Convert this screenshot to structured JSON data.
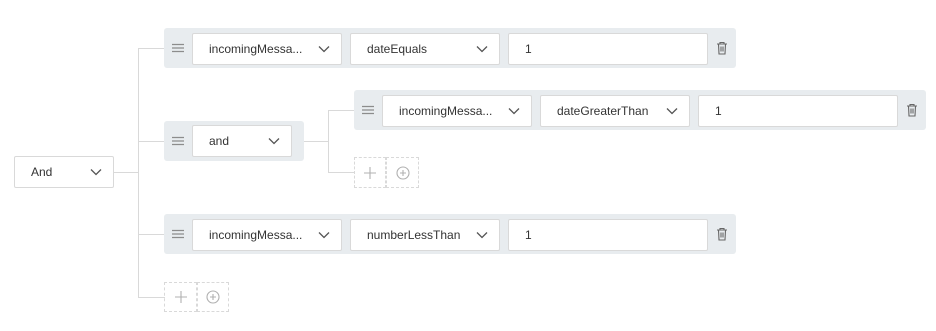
{
  "root": {
    "operator": "And"
  },
  "rules": [
    {
      "field": "incomingMessa...",
      "operator": "dateEquals",
      "value": "1"
    },
    {
      "group_operator": "and",
      "rules": [
        {
          "field": "incomingMessa...",
          "operator": "dateGreaterThan",
          "value": "1"
        }
      ]
    },
    {
      "field": "incomingMessa...",
      "operator": "numberLessThan",
      "value": "1"
    }
  ],
  "icons": {
    "drag": "drag-handle-icon",
    "delete": "trash-icon",
    "add_rule": "plus-icon",
    "add_group": "circle-plus-icon",
    "dropdown": "chevron-down-icon"
  },
  "colors": {
    "card_bg": "#e8ecef",
    "border": "#d9d9d9",
    "text": "#333333",
    "icon": "#8c8c8c"
  }
}
